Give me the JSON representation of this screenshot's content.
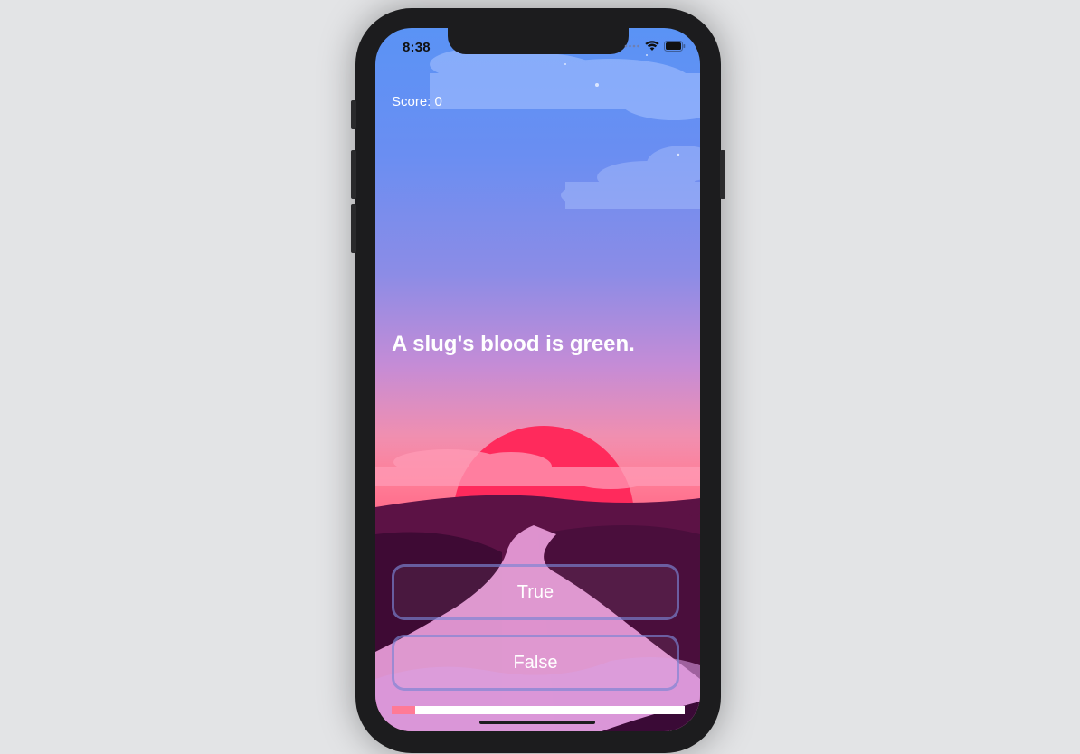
{
  "status_bar": {
    "time": "8:38"
  },
  "game": {
    "score_text": "Score: 0",
    "question": "A slug's blood is green.",
    "answers": {
      "true_label": "True",
      "false_label": "False"
    },
    "progress": 0.08
  },
  "colors": {
    "progress_fill": "#ff7a96",
    "progress_track": "#ffffff",
    "button_border": "#7882d2",
    "text": "#ffffff"
  },
  "icons": [
    "wifi-icon",
    "battery-icon",
    "signal-icon"
  ]
}
